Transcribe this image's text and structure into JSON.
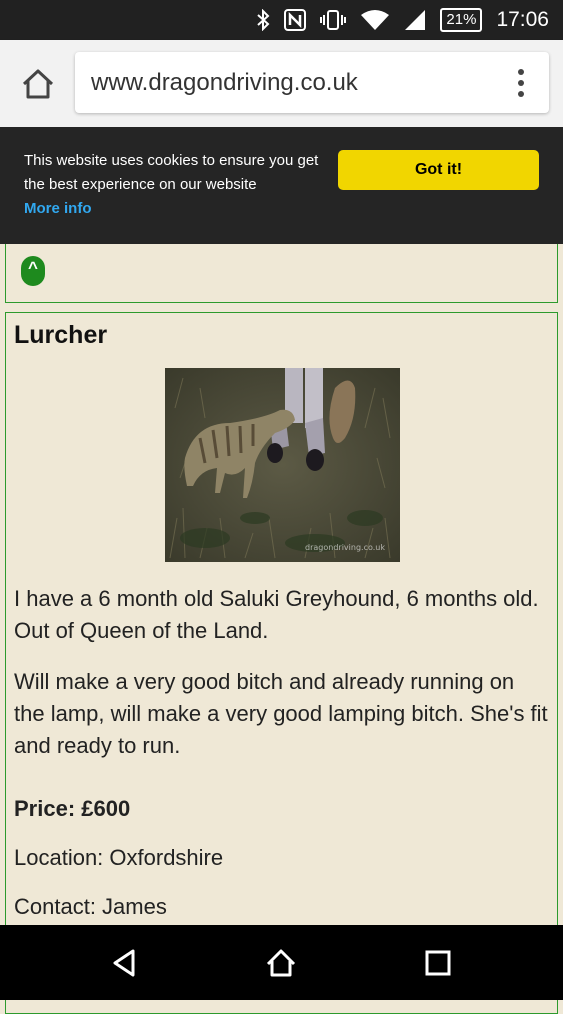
{
  "status_bar": {
    "battery": "21%",
    "time": "17:06",
    "icons": [
      "bluetooth-icon",
      "nfc-icon",
      "vibrate-icon",
      "wifi-icon",
      "signal-icon",
      "battery-icon"
    ]
  },
  "browser": {
    "url": "www.dragondriving.co.uk"
  },
  "cookie_banner": {
    "message": "This website uses cookies to ensure you get the best experience on our website",
    "more_info": "More info",
    "button": "Got it!"
  },
  "top_box": {
    "up_button": "^"
  },
  "listing": {
    "title": "Lurcher",
    "watermark": "dragondriving.co.uk",
    "paragraph1": "I have a 6 month old Saluki Greyhound, 6 months old. Out of Queen of the Land.",
    "paragraph2": "Will make a very good bitch and already running on the lamp, will make a very good lamping bitch. She's fit and ready to run.",
    "price": "Price: £600",
    "location": "Location: Oxfordshire",
    "contact": "Contact: James"
  },
  "colors": {
    "page_bg": "#efe8d6",
    "border_green": "#2d9a2d",
    "cookie_button": "#f1d600",
    "more_info_link": "#31a8f0"
  }
}
